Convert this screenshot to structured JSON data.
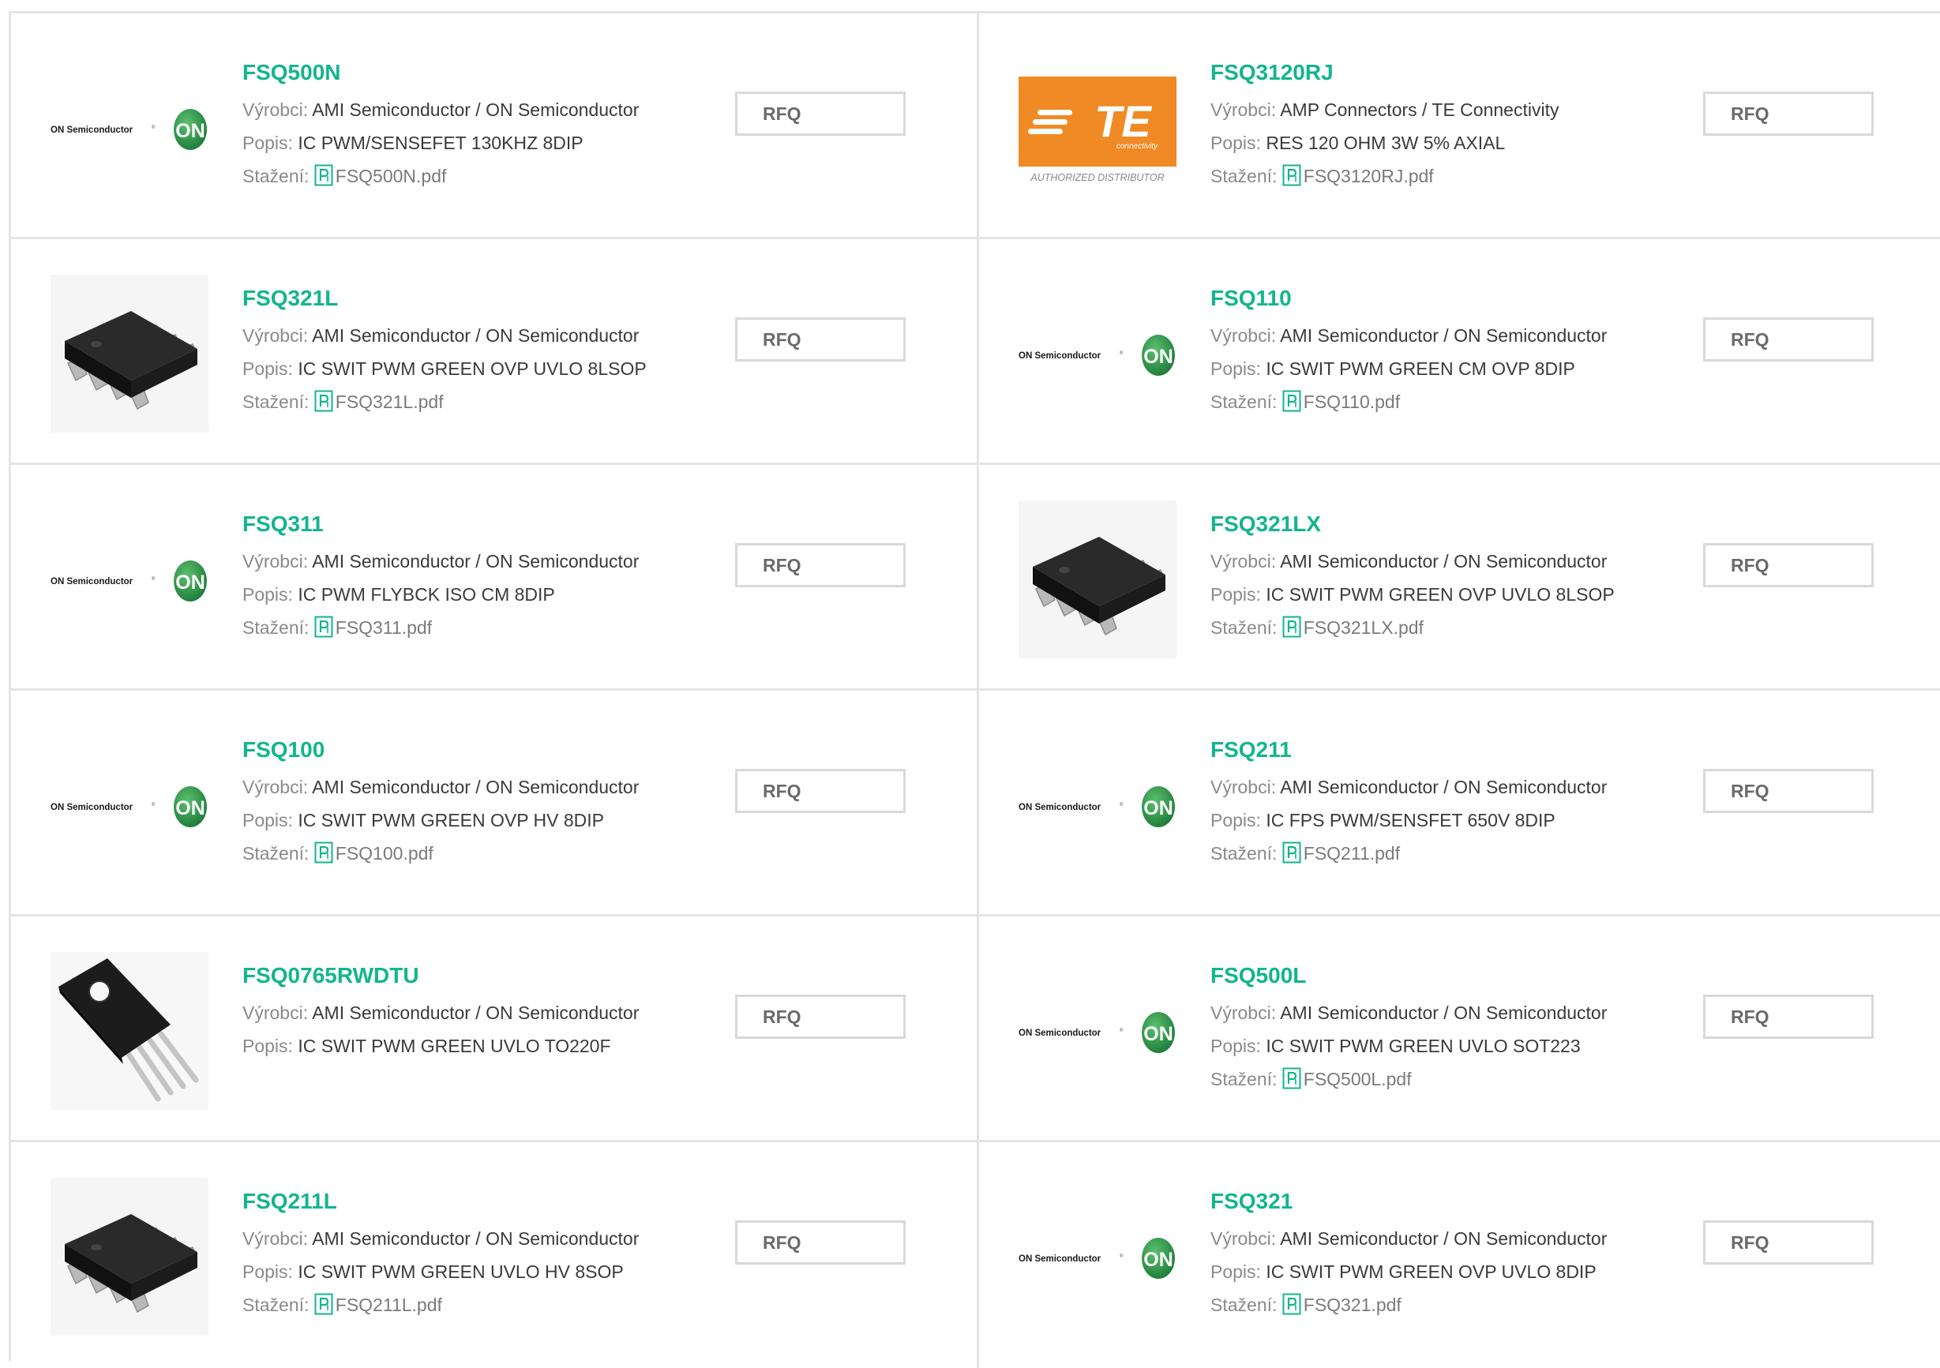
{
  "labels": {
    "manufacturer": "Výrobci: ",
    "description": "Popis: ",
    "download": "Stažení: ",
    "rfq": "RFQ"
  },
  "colors": {
    "accent": "#13b58d",
    "on_semi_green": "#2e9c4b",
    "te_orange": "#f08a24"
  },
  "te_logo": {
    "mark": "TE",
    "sub": "connectivity",
    "caption": "AUTHORIZED DISTRIBUTOR"
  },
  "on_logo": {
    "text": "ON Semiconductor",
    "badge": "ON"
  },
  "products": [
    {
      "name": "FSQ500N",
      "manufacturer": "AMI Semiconductor / ON Semiconductor",
      "description": "IC PWM/SENSEFET 130KHZ 8DIP",
      "pdf": "FSQ500N.pdf",
      "image": "on-semiconductor-logo"
    },
    {
      "name": "FSQ3120RJ",
      "manufacturer": "AMP Connectors / TE Connectivity",
      "description": "RES 120 OHM 3W 5% AXIAL",
      "pdf": "FSQ3120RJ.pdf",
      "image": "te-connectivity-logo"
    },
    {
      "name": "FSQ321L",
      "manufacturer": "AMI Semiconductor / ON Semiconductor",
      "description": "IC SWIT PWM GREEN OVP UVLO 8LSOP",
      "pdf": "FSQ321L.pdf",
      "image": "sop8-chip"
    },
    {
      "name": "FSQ110",
      "manufacturer": "AMI Semiconductor / ON Semiconductor",
      "description": "IC SWIT PWM GREEN CM OVP 8DIP",
      "pdf": "FSQ110.pdf",
      "image": "on-semiconductor-logo"
    },
    {
      "name": "FSQ311",
      "manufacturer": "AMI Semiconductor / ON Semiconductor",
      "description": "IC PWM FLYBCK ISO CM 8DIP",
      "pdf": "FSQ311.pdf",
      "image": "on-semiconductor-logo"
    },
    {
      "name": "FSQ321LX",
      "manufacturer": "AMI Semiconductor / ON Semiconductor",
      "description": "IC SWIT PWM GREEN OVP UVLO 8LSOP",
      "pdf": "FSQ321LX.pdf",
      "image": "sop8-chip"
    },
    {
      "name": "FSQ100",
      "manufacturer": "AMI Semiconductor / ON Semiconductor",
      "description": "IC SWIT PWM GREEN OVP HV 8DIP",
      "pdf": "FSQ100.pdf",
      "image": "on-semiconductor-logo"
    },
    {
      "name": "FSQ211",
      "manufacturer": "AMI Semiconductor / ON Semiconductor",
      "description": "IC FPS PWM/SENSFET 650V 8DIP",
      "pdf": "FSQ211.pdf",
      "image": "on-semiconductor-logo"
    },
    {
      "name": "FSQ0765RWDTU",
      "manufacturer": "AMI Semiconductor / ON Semiconductor",
      "description": "IC SWIT PWM GREEN UVLO TO220F",
      "pdf": null,
      "image": "to220-chip"
    },
    {
      "name": "FSQ500L",
      "manufacturer": "AMI Semiconductor / ON Semiconductor",
      "description": "IC SWIT PWM GREEN UVLO SOT223",
      "pdf": "FSQ500L.pdf",
      "image": "on-semiconductor-logo"
    },
    {
      "name": "FSQ211L",
      "manufacturer": "AMI Semiconductor / ON Semiconductor",
      "description": "IC SWIT PWM GREEN UVLO HV 8SOP",
      "pdf": "FSQ211L.pdf",
      "image": "sop8-chip"
    },
    {
      "name": "FSQ321",
      "manufacturer": "AMI Semiconductor / ON Semiconductor",
      "description": "IC SWIT PWM GREEN OVP UVLO 8DIP",
      "pdf": "FSQ321.pdf",
      "image": "on-semiconductor-logo"
    }
  ]
}
